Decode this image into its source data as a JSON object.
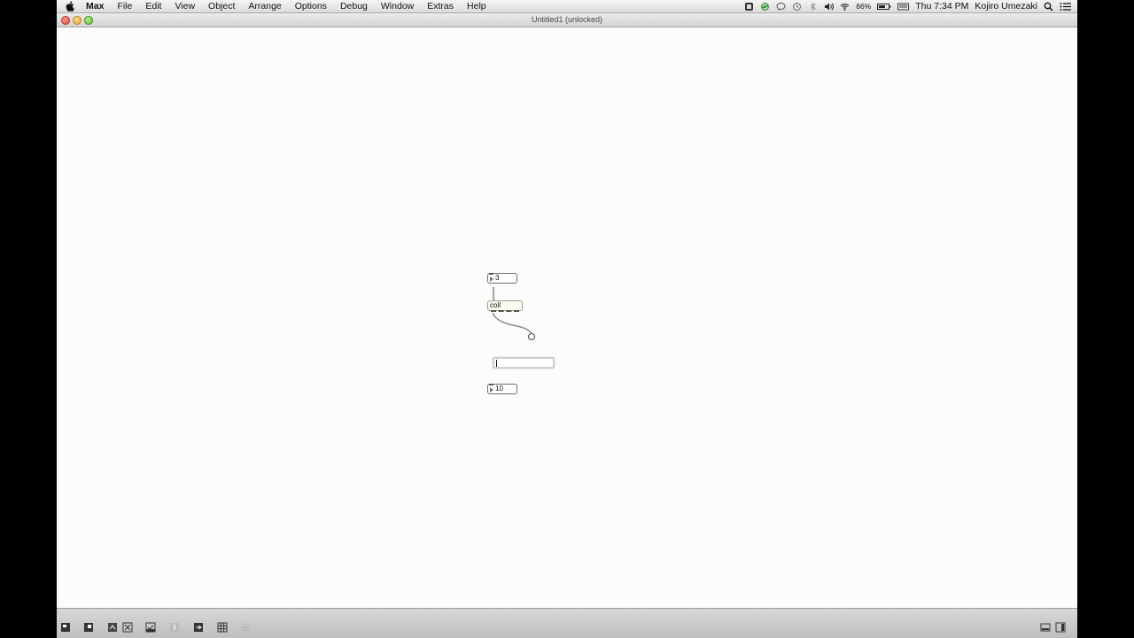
{
  "menubar": {
    "app": "Max",
    "menus": [
      "File",
      "Edit",
      "View",
      "Object",
      "Arrange",
      "Options",
      "Debug",
      "Window",
      "Extras",
      "Help"
    ],
    "battery": "66%",
    "clock": "Thu 7:34 PM",
    "user": "Kojiro Umezaki",
    "status_icons": [
      "max-status-icon",
      "sync-icon",
      "chat-icon",
      "time-machine-icon",
      "bluetooth-icon",
      "volume-icon",
      "wifi-icon",
      "battery-icon",
      "keyboard-icon",
      "spotlight-icon",
      "notification-center-icon"
    ]
  },
  "window": {
    "title": "Untitled1 (unlocked)"
  },
  "patcher": {
    "number_top": "3",
    "coll_object": "coll",
    "new_object_text": "",
    "number_bottom": "10"
  },
  "toolbar": {
    "icons": [
      "lock-icon",
      "presentation-icon",
      "new-object-icon",
      "close-object-icon",
      "inspector-icon",
      "info-icon",
      "sidebar-icon",
      "grid-icon",
      "settings-icon",
      "split-left-icon",
      "split-right-icon"
    ]
  }
}
